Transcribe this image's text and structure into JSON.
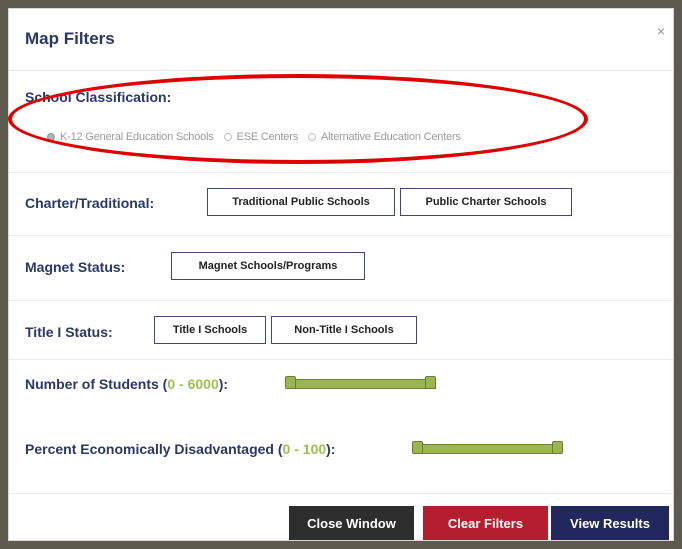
{
  "modal": {
    "title": "Map Filters",
    "close_glyph": "×"
  },
  "school_classification": {
    "label": "School Classification:",
    "options": [
      {
        "label": "K-12 General Education Schools",
        "selected": true
      },
      {
        "label": "ESE Centers",
        "selected": false
      },
      {
        "label": "Alternative Education Centers",
        "selected": false
      }
    ]
  },
  "charter": {
    "label": "Charter/Traditional:",
    "buttons": [
      "Traditional Public Schools",
      "Public Charter Schools"
    ]
  },
  "magnet": {
    "label": "Magnet Status:",
    "buttons": [
      "Magnet Schools/Programs"
    ]
  },
  "title1": {
    "label": "Title I Status:",
    "buttons": [
      "Title I Schools",
      "Non-Title I Schools"
    ]
  },
  "students": {
    "label_prefix": "Number of Students (",
    "range_low": "0",
    "range_sep": " - ",
    "range_high": "6000",
    "label_suffix": "):",
    "min": 0,
    "max": 6000
  },
  "econ": {
    "label_prefix": "Percent Economically Disadvantaged (",
    "range_low": "0",
    "range_sep": " - ",
    "range_high": "100",
    "label_suffix": "):",
    "min": 0,
    "max": 100
  },
  "footer": {
    "close_label": "Close Window",
    "clear_label": "Clear Filters",
    "view_label": "View Results"
  },
  "colors": {
    "heading": "#2b3766",
    "highlight": "#9bc24a",
    "close_btn": "#2e2e2e",
    "clear_btn": "#b51e2e",
    "view_btn": "#22285e",
    "annotation": "#e00000"
  }
}
